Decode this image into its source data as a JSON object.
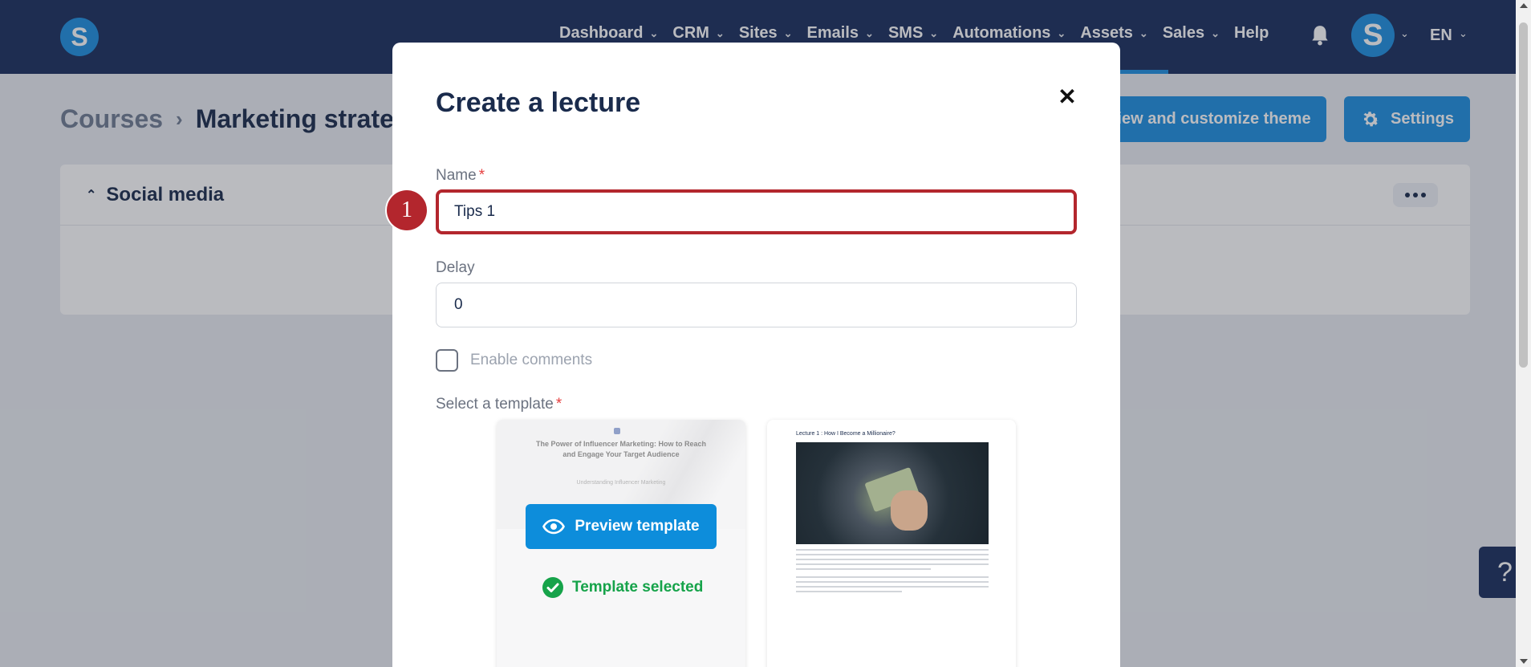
{
  "nav": {
    "logo": "S",
    "items": [
      {
        "label": "Dashboard"
      },
      {
        "label": "CRM"
      },
      {
        "label": "Sites"
      },
      {
        "label": "Emails"
      },
      {
        "label": "SMS"
      },
      {
        "label": "Automations"
      },
      {
        "label": "Assets",
        "active": true
      },
      {
        "label": "Sales"
      }
    ],
    "help": "Help",
    "avatar": "S",
    "lang": "EN"
  },
  "page": {
    "breadcrumb_root": "Courses",
    "breadcrumb_current": "Marketing strateg",
    "theme_button": "View and customize theme",
    "settings_button": "Settings",
    "section_title": "Social media",
    "help_fab": "?"
  },
  "modal": {
    "title": "Create a lecture",
    "name_label": "Name",
    "name_value": "Tips 1",
    "step_badge": "1",
    "delay_label": "Delay",
    "delay_value": "0",
    "enable_comments_label": "Enable comments",
    "template_label": "Select a template",
    "required_mark": "*",
    "templates": [
      {
        "thumb_title": "The Power of Influencer Marketing: How to Reach and Engage Your Target Audience",
        "thumb_subtitle": "Understanding Influencer Marketing",
        "preview_label": "Preview template",
        "selected_label": "Template selected"
      },
      {
        "thumb_title": "Lecture 1 : How I Become a Millionaire?"
      }
    ]
  },
  "colors": {
    "nav_bg": "#1a2f5e",
    "primary": "#1e8fe1",
    "highlight": "#b3262d",
    "success": "#16a34a"
  },
  "icons": [
    "chevron-down-icon",
    "bell-icon",
    "chevron-right-icon",
    "gear-icon",
    "chevron-up-icon",
    "more-icon",
    "close-icon",
    "eye-icon",
    "check-circle-icon",
    "question-icon"
  ]
}
